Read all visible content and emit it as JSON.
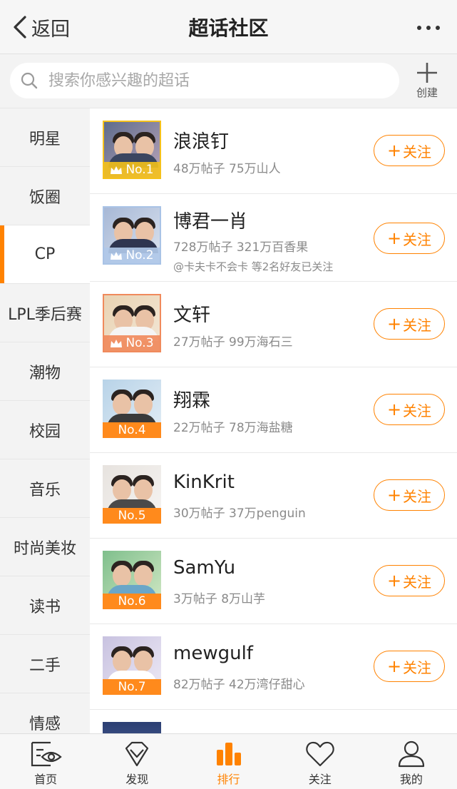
{
  "header": {
    "back_label": "返回",
    "title": "超话社区"
  },
  "search": {
    "placeholder": "搜索你感兴趣的超话",
    "create_label": "创建"
  },
  "sidebar": {
    "items": [
      {
        "label": "明星"
      },
      {
        "label": "饭圈"
      },
      {
        "label": "CP"
      },
      {
        "label": "LPL季后赛"
      },
      {
        "label": "潮物"
      },
      {
        "label": "校园"
      },
      {
        "label": "音乐"
      },
      {
        "label": "时尚美妆"
      },
      {
        "label": "读书"
      },
      {
        "label": "二手"
      },
      {
        "label": "情感"
      }
    ],
    "active_index": 2
  },
  "list": {
    "follow_label": "关注",
    "items": [
      {
        "name": "浪浪钉",
        "stats": "48万帖子 75万山人",
        "rank": "No.1",
        "badge": "gold"
      },
      {
        "name": "博君一肖",
        "stats": "728万帖子 321万百香果",
        "friends": "@卡夫卡不会卡 等2名好友已关注",
        "rank": "No.2",
        "badge": "silver"
      },
      {
        "name": "文轩",
        "stats": "27万帖子 99万海石三",
        "rank": "No.3",
        "badge": "bronze"
      },
      {
        "name": "翔霖",
        "stats": "22万帖子 78万海盐糖",
        "rank": "No.4",
        "badge": "plain"
      },
      {
        "name": "KinKrit",
        "stats": "30万帖子 37万penguin",
        "rank": "No.5",
        "badge": "plain"
      },
      {
        "name": "SamYu",
        "stats": "3万帖子 8万山芋",
        "rank": "No.6",
        "badge": "plain"
      },
      {
        "name": "mewgulf",
        "stats": "82万帖子 42万湾仔甜心",
        "rank": "No.7",
        "badge": "plain"
      }
    ]
  },
  "tabbar": {
    "items": [
      {
        "label": "首页",
        "icon": "home-eye-icon"
      },
      {
        "label": "发现",
        "icon": "discover-diamond-icon"
      },
      {
        "label": "排行",
        "icon": "ranking-bars-icon"
      },
      {
        "label": "关注",
        "icon": "heart-icon"
      },
      {
        "label": "我的",
        "icon": "profile-icon"
      }
    ],
    "active_index": 2
  },
  "colors": {
    "accent": "#ff8200",
    "gold": "#f5c11b",
    "silver": "#a9c3e6",
    "bronze": "#f08a5c"
  }
}
